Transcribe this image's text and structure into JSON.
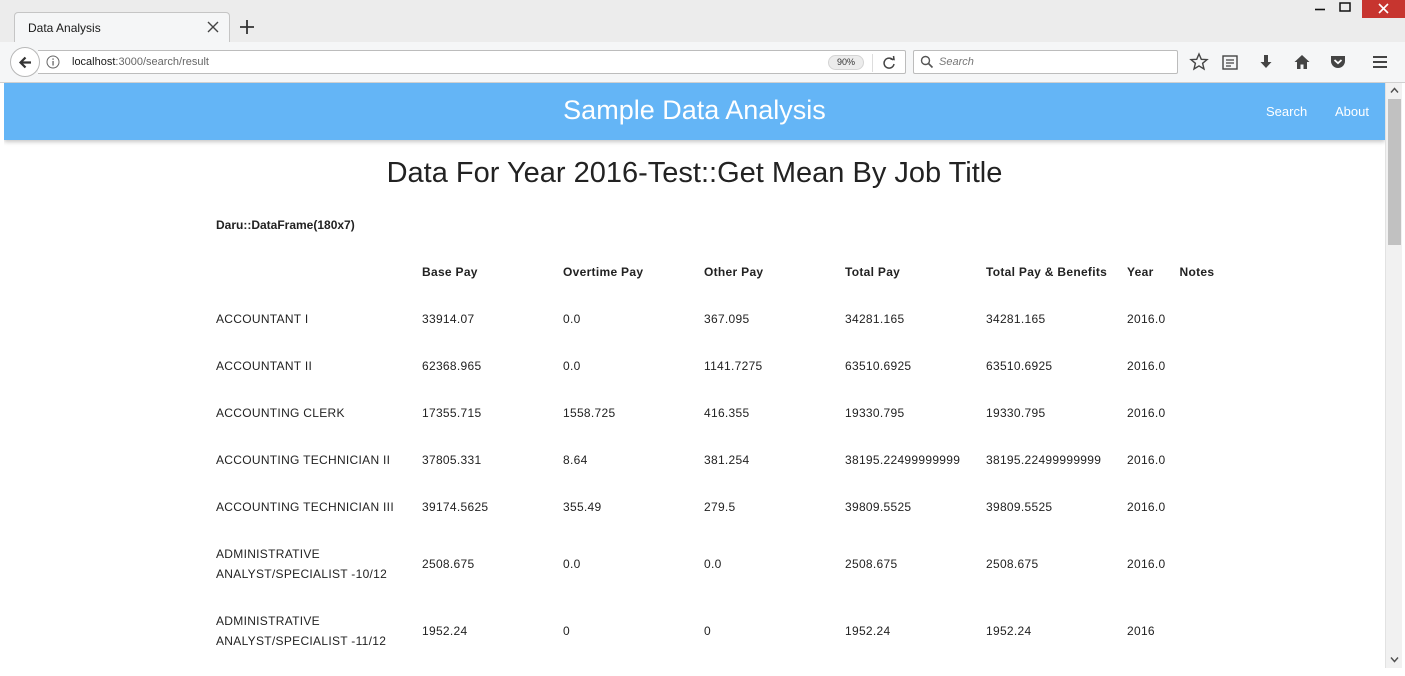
{
  "browser": {
    "tab_title": "Data Analysis",
    "url_host": "localhost",
    "url_path": ":3000/search/result",
    "zoom": "90%",
    "search_placeholder": "Search"
  },
  "app": {
    "brand": "Sample Data Analysis",
    "nav": {
      "search": "Search",
      "about": "About"
    }
  },
  "page": {
    "title": "Data For Year 2016-Test::Get Mean By Job Title",
    "dataframe_label": "Daru::DataFrame(180x7)"
  },
  "table": {
    "headers": [
      "",
      "Base Pay",
      "Overtime Pay",
      "Other Pay",
      "Total Pay",
      "Total Pay & Benefits",
      "Year",
      "Notes"
    ],
    "rows": [
      [
        "ACCOUNTANT I",
        "33914.07",
        "0.0",
        "367.095",
        "34281.165",
        "34281.165",
        "2016.0",
        ""
      ],
      [
        "ACCOUNTANT II",
        "62368.965",
        "0.0",
        "1141.7275",
        "63510.6925",
        "63510.6925",
        "2016.0",
        ""
      ],
      [
        "ACCOUNTING CLERK",
        "17355.715",
        "1558.725",
        "416.355",
        "19330.795",
        "19330.795",
        "2016.0",
        ""
      ],
      [
        "ACCOUNTING TECHNICIAN II",
        "37805.331",
        "8.64",
        "381.254",
        "38195.22499999999",
        "38195.22499999999",
        "2016.0",
        ""
      ],
      [
        "ACCOUNTING TECHNICIAN III",
        "39174.5625",
        "355.49",
        "279.5",
        "39809.5525",
        "39809.5525",
        "2016.0",
        ""
      ],
      [
        "ADMINISTRATIVE ANALYST/SPECIALIST -10/12",
        "2508.675",
        "0.0",
        "0.0",
        "2508.675",
        "2508.675",
        "2016.0",
        ""
      ],
      [
        "ADMINISTRATIVE ANALYST/SPECIALIST -11/12",
        "1952.24",
        "0",
        "0",
        "1952.24",
        "1952.24",
        "2016",
        ""
      ]
    ]
  }
}
